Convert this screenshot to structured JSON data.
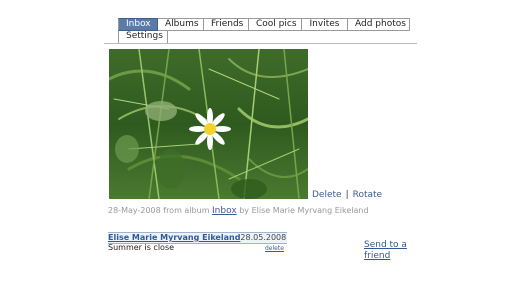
{
  "tabs": {
    "row1": [
      "Inbox",
      "Albums",
      "Friends",
      "Cool pics",
      "Invites",
      "Add photos"
    ],
    "row2": [
      "Settings"
    ],
    "active": "Inbox"
  },
  "photo": {
    "subject": "daisy-in-grass"
  },
  "actions": {
    "delete": "Delete",
    "separator": "|",
    "rotate": "Rotate"
  },
  "meta": {
    "prefix": "28-May-2008 from album ",
    "album": "Inbox",
    "suffix": " by Elise Marie Myrvang Eikeland"
  },
  "comment": {
    "author": "Elise Marie Myrvang Eikeland",
    "date": "28.05.2008",
    "text": "Summer is close",
    "delete": "delete"
  },
  "send_to_friend": "Send to a friend",
  "colors": {
    "active_tab": "#5a7ba8",
    "link": "#2f5a94"
  }
}
